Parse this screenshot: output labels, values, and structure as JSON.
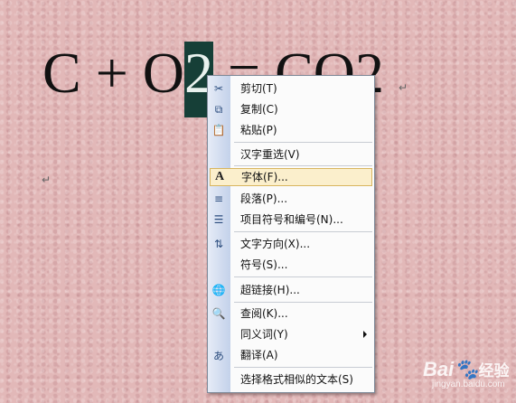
{
  "document": {
    "equation_before": "C + O",
    "equation_selected": "2",
    "equation_after": " = CO2",
    "paragraph_mark": "↵"
  },
  "context_menu": {
    "items": [
      {
        "label": "剪切(T)",
        "icon": "scissors-icon",
        "glyph": "✂"
      },
      {
        "label": "复制(C)",
        "icon": "copy-icon",
        "glyph": "⧉"
      },
      {
        "label": "粘贴(P)",
        "icon": "paste-icon",
        "glyph": "📋"
      },
      {
        "label": "汉字重选(V)",
        "icon": "",
        "glyph": ""
      },
      {
        "label": "字体(F)...",
        "icon": "font-icon",
        "glyph": "A",
        "highlighted": true
      },
      {
        "label": "段落(P)...",
        "icon": "paragraph-icon",
        "glyph": "≡"
      },
      {
        "label": "项目符号和编号(N)...",
        "icon": "bullets-icon",
        "glyph": "☰"
      },
      {
        "label": "文字方向(X)...",
        "icon": "text-direction-icon",
        "glyph": "⇅"
      },
      {
        "label": "符号(S)...",
        "icon": "",
        "glyph": ""
      },
      {
        "label": "超链接(H)...",
        "icon": "hyperlink-icon",
        "glyph": "🌐"
      },
      {
        "label": "查阅(K)...",
        "icon": "research-icon",
        "glyph": "🔍"
      },
      {
        "label": "同义词(Y)",
        "icon": "",
        "glyph": "",
        "submenu": true
      },
      {
        "label": "翻译(A)",
        "icon": "translate-icon",
        "glyph": "あ"
      },
      {
        "label": "选择格式相似的文本(S)",
        "icon": "",
        "glyph": ""
      }
    ]
  },
  "watermark": {
    "brand": "Bai",
    "brand2": "经验",
    "url": "jingyan.baidu.com"
  }
}
